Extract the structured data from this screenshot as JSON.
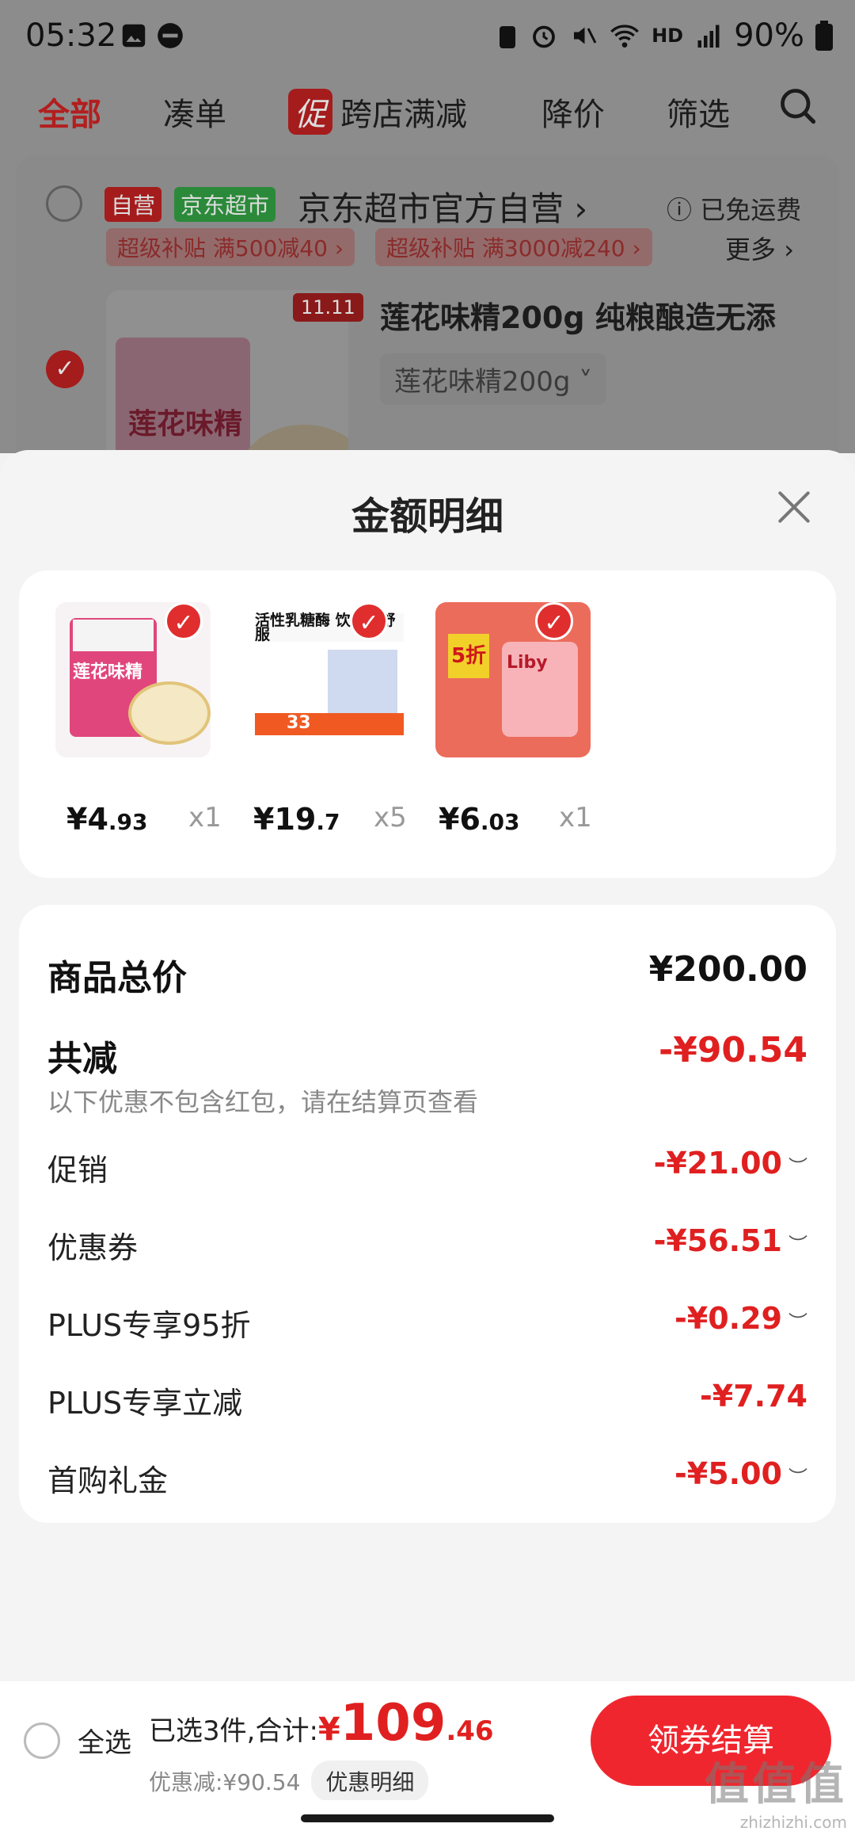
{
  "status": {
    "time": "05:32",
    "network": "HD",
    "battery": "90%"
  },
  "tabs": [
    {
      "label": "全部",
      "active": true
    },
    {
      "label": "凑单"
    },
    {
      "label": "跨店满减",
      "badge": "促"
    },
    {
      "label": "降价"
    },
    {
      "label": "筛选"
    }
  ],
  "shop": {
    "tag_self": "自营",
    "tag_market": "京东超市",
    "name": "京东超市官方自营",
    "shipping": "已免运费",
    "coupons": [
      "超级补贴 满500减40",
      "超级补贴 满3000减240"
    ],
    "more": "更多",
    "product_title": "莲花味精200g 纯粮酿造无添",
    "product_spec": "莲花味精200g",
    "product_badge": "11.11",
    "product_img_text": "莲花味精"
  },
  "sheet": {
    "title": "金额明细",
    "items": [
      {
        "price_int": "¥4",
        "price_dec": ".93",
        "qty": "x1",
        "img_text": "莲花味精"
      },
      {
        "price_int": "¥19",
        "price_dec": ".7",
        "qty": "x5",
        "img_text": "活性乳糖酶 饮奶更舒服",
        "img_sub": "33"
      },
      {
        "price_int": "¥6",
        "price_dec": ".03",
        "qty": "x1",
        "img_text": "5折",
        "img_brand": "Liby"
      }
    ],
    "total_label": "商品总价",
    "total_value": "¥200.00",
    "reduce_label": "共减",
    "reduce_value": "-¥90.54",
    "note": "以下优惠不包含红包，请在结算页查看",
    "rows": [
      {
        "label": "促销",
        "value": "-¥21.00",
        "chevron": true
      },
      {
        "label": "优惠券",
        "value": "-¥56.51",
        "chevron": true
      },
      {
        "label": "PLUS专享95折",
        "value": "-¥0.29",
        "chevron": true
      },
      {
        "label": "PLUS专享立减",
        "value": "-¥7.74",
        "chevron": false
      },
      {
        "label": "首购礼金",
        "value": "-¥5.00",
        "chevron": true
      }
    ]
  },
  "bottom": {
    "select_all": "全选",
    "selected_text": "已选3件,合计:",
    "currency": "¥",
    "total_int": "109",
    "total_dec": ".46",
    "discount_text": "优惠减:¥90.54",
    "detail_button": "优惠明细",
    "checkout": "领券结算"
  },
  "watermark": {
    "main": "值值值",
    "sub": "zhizhizhi.com"
  }
}
